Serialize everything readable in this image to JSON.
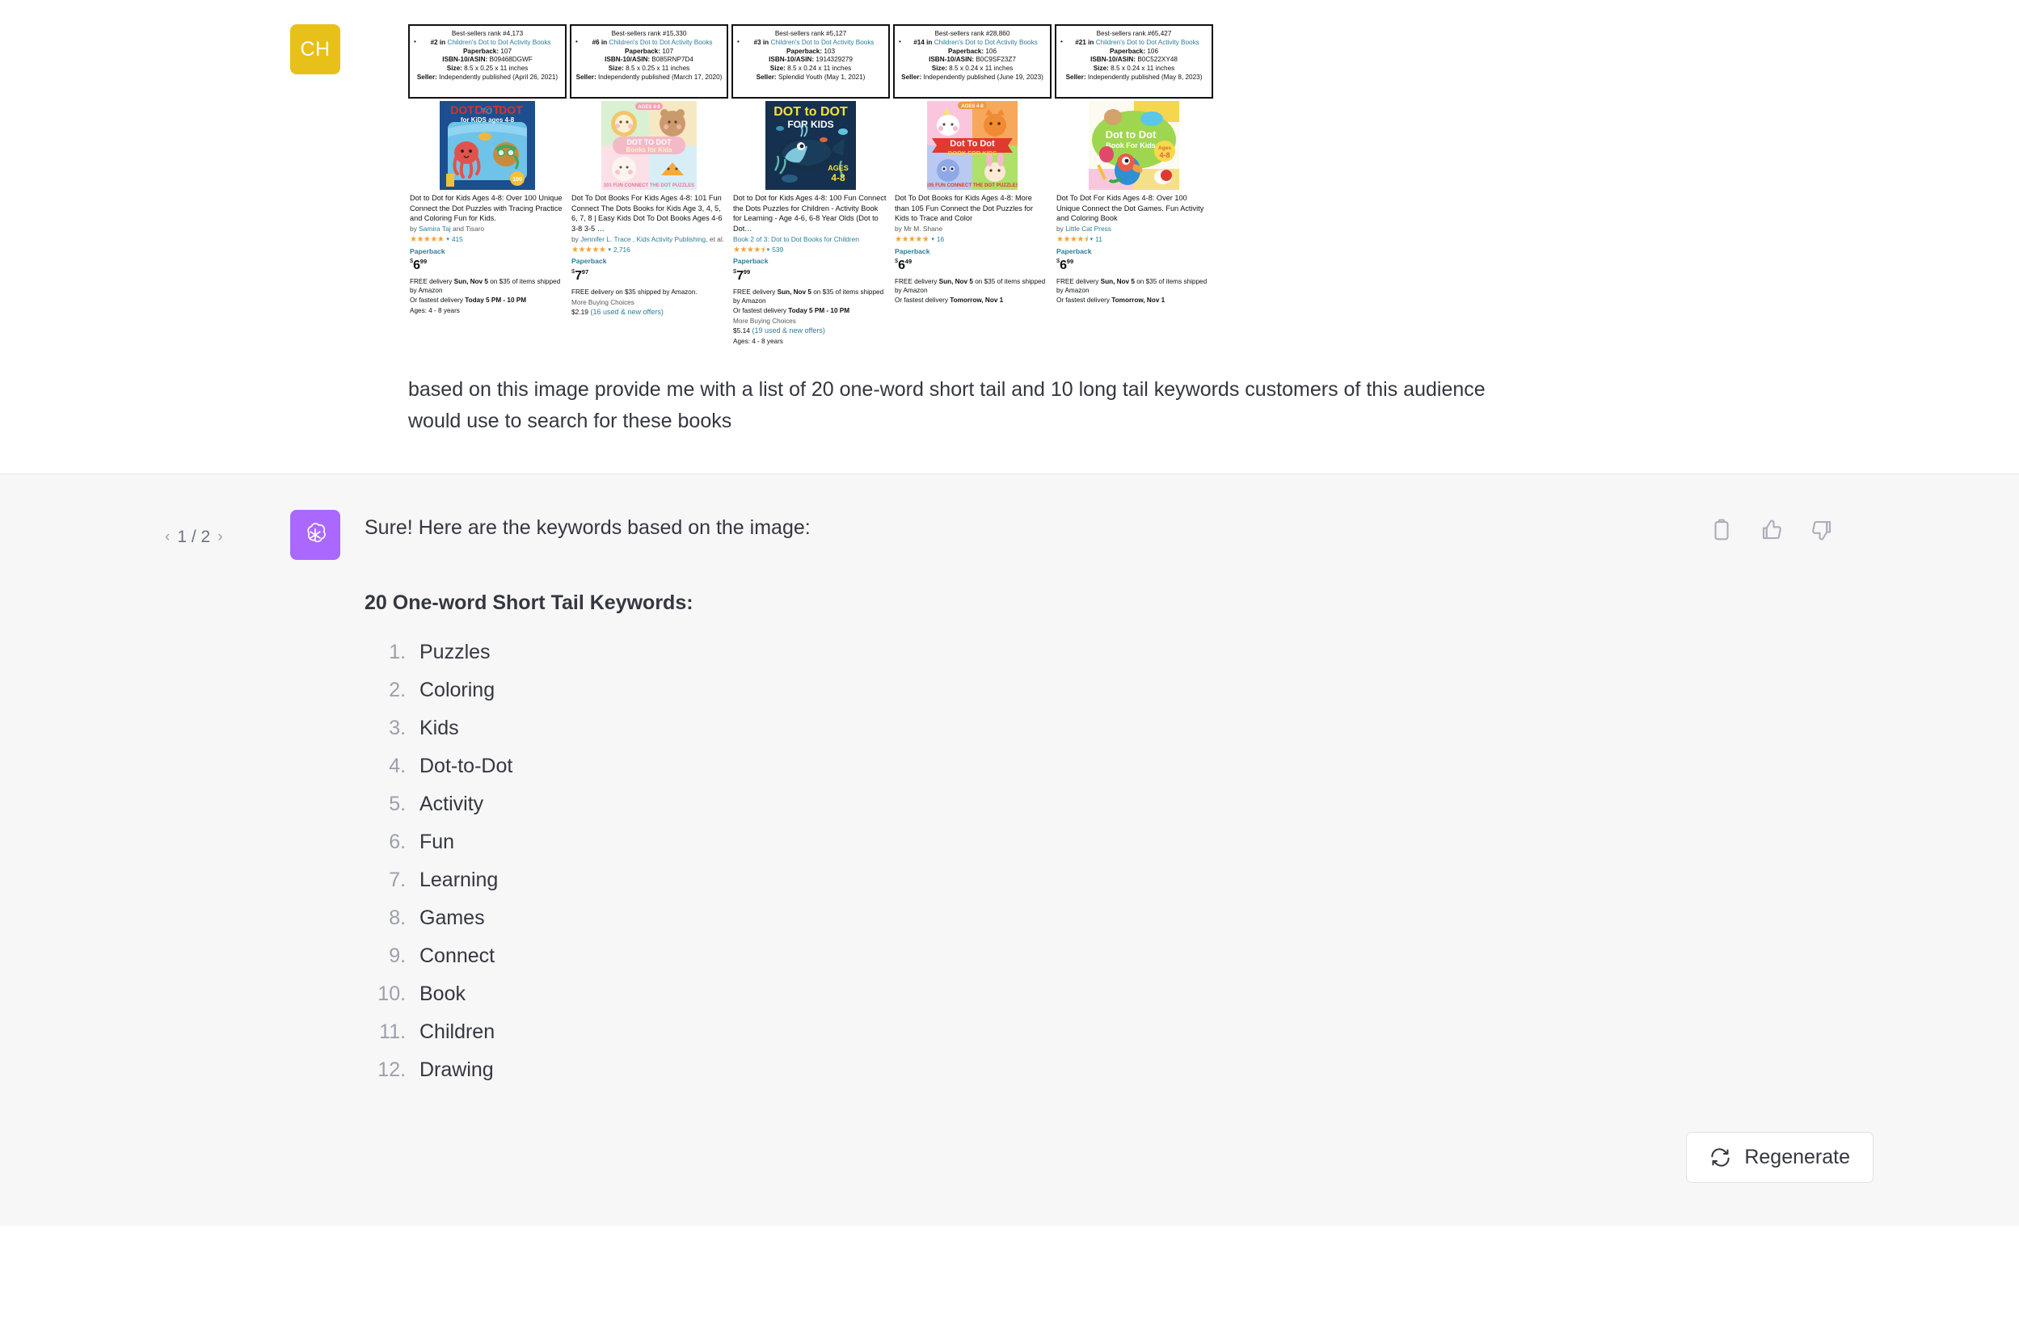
{
  "user": {
    "avatar_initials": "CH",
    "prompt": "based on this image provide me with a list of 20 one-word short tail and 10 long tail keywords customers of this audience would use to search for these books",
    "products": [
      {
        "rank_line": "Best-sellers rank #4,173",
        "cat_rank": "#2 in",
        "cat_link": "Children's Dot to Dot Activity Books",
        "paperback_label": "Paperback:",
        "paperback": "107",
        "isbn_label": "ISBN-10/ASIN:",
        "isbn": "B09468DGWF",
        "size_label": "Size:",
        "size": "8.5 x 0.25 x 11 inches",
        "seller_label": "Seller:",
        "seller": "Independently published (April 26, 2021)",
        "title": "Dot to Dot for Kids Ages 4-8: Over 100 Unique Connect the Dot Puzzles with Tracing Practice and Coloring Fun for Kids.",
        "by_prefix": "by",
        "authors": "Samira Taj",
        "by_suffix": "and Tisaro",
        "series": "",
        "stars": 5,
        "reviews": "415",
        "binding": "Paperback",
        "price_cur": "$",
        "price_whole": "6",
        "price_frac": "99",
        "ship1": "FREE delivery",
        "ship1_b": "Sun, Nov 5",
        "ship1_tail": "on $35 of items shipped by Amazon",
        "ship2": "Or fastest delivery",
        "ship2_b": "Today 5 PM - 10 PM",
        "more_buying": "",
        "mbc_price": "",
        "mbc_offers": "",
        "ages": "Ages: 4 - 8 years",
        "cover": "octopus-ocean-blue"
      },
      {
        "rank_line": "Best-sellers rank #15,330",
        "cat_rank": "#6 in",
        "cat_link": "Children's Dot to Dot Activity Books",
        "paperback_label": "Paperback:",
        "paperback": "107",
        "isbn_label": "ISBN-10/ASIN:",
        "isbn": "B085RNP7D4",
        "size_label": "Size:",
        "size": "8.5 x 0.25 x 11 inches",
        "seller_label": "Seller:",
        "seller": "Independently published (March 17, 2020)",
        "title": "Dot To Dot Books For Kids Ages 4-8: 101 Fun Connect The Dots Books for Kids Age 3, 4, 5, 6, 7, 8 | Easy Kids Dot To Dot Books Ages 4-6 3-8 3-5 …",
        "by_prefix": "by",
        "authors": "Jennifer L. Trace , Kids Activity Publishing",
        "by_suffix": ", et al.",
        "series": "",
        "stars": 5,
        "reviews": "2,716",
        "binding": "Paperback",
        "price_cur": "$",
        "price_whole": "7",
        "price_frac": "97",
        "ship1": "FREE delivery on $35 shipped by Amazon.",
        "ship1_b": "",
        "ship1_tail": "",
        "ship2": "",
        "ship2_b": "",
        "more_buying": "More Buying Choices",
        "mbc_price": "$2.19",
        "mbc_offers": "(16 used & new offers)",
        "ages": "",
        "cover": "pastel-animals"
      },
      {
        "rank_line": "Best-sellers rank #5,127",
        "cat_rank": "#3 in",
        "cat_link": "Children's Dot to Dot Activity Books",
        "paperback_label": "Paperback:",
        "paperback": "103",
        "isbn_label": "ISBN-10/ASIN:",
        "isbn": "1914329279",
        "size_label": "Size:",
        "size": "8.5 x 0.24 x 11 inches",
        "seller_label": "Seller:",
        "seller": "Splendid Youth (May 1, 2021)",
        "title": "Dot to Dot for Kids Ages 4-8: 100 Fun Connect the Dots Puzzles for Children - Activity Book for Learning - Age 4-6, 6-8 Year Olds (Dot to Dot…",
        "by_prefix": "",
        "authors": "",
        "by_suffix": "",
        "series": "Book 2 of 3: Dot to Dot Books for Children",
        "stars": 4.5,
        "reviews": "539",
        "binding": "Paperback",
        "price_cur": "$",
        "price_whole": "7",
        "price_frac": "99",
        "ship1": "FREE delivery",
        "ship1_b": "Sun, Nov 5",
        "ship1_tail": "on $35 of items shipped by Amazon",
        "ship2": "Or fastest delivery",
        "ship2_b": "Today 5 PM - 10 PM",
        "more_buying": "More Buying Choices",
        "mbc_price": "$5.14",
        "mbc_offers": "(19 used & new offers)",
        "ages": "Ages: 4 - 8 years",
        "cover": "whale-navy"
      },
      {
        "rank_line": "Best-sellers rank #28,860",
        "cat_rank": "#14 in",
        "cat_link": "Children's Dot to Dot Activity Books",
        "paperback_label": "Paperback:",
        "paperback": "106",
        "isbn_label": "ISBN-10/ASIN:",
        "isbn": "B0C9SF23Z7",
        "size_label": "Size:",
        "size": "8.5 x 0.24 x 11 inches",
        "seller_label": "Seller:",
        "seller": "Independently published (June 19, 2023)",
        "title": "Dot To Dot Books for Kids Ages 4-8: More than 105 Fun Connect the Dot Puzzles for Kids to Trace and Color",
        "by_prefix": "by",
        "authors": "Mr M. Shane",
        "by_suffix": "",
        "series": "",
        "stars": 5,
        "reviews": "16",
        "binding": "Paperback",
        "price_cur": "$",
        "price_whole": "6",
        "price_frac": "49",
        "ship1": "FREE delivery",
        "ship1_b": "Sun, Nov 5",
        "ship1_tail": "on $35 of items shipped by Amazon",
        "ship2": "Or fastest delivery",
        "ship2_b": "Tomorrow, Nov 1",
        "more_buying": "",
        "mbc_price": "",
        "mbc_offers": "",
        "ages": "",
        "cover": "quad-animals-red-banner"
      },
      {
        "rank_line": "Best-sellers rank #65,427",
        "cat_rank": "#21 in",
        "cat_link": "Children's Dot to Dot Activity Books",
        "paperback_label": "Paperback:",
        "paperback": "106",
        "isbn_label": "ISBN-10/ASIN:",
        "isbn": "B0C522XY48",
        "size_label": "Size:",
        "size": "8.5 x 0.24 x 11 inches",
        "seller_label": "Seller:",
        "seller": "Independently published (May 8, 2023)",
        "title": "Dot To Dot For Kids Ages 4-8: Over 100 Unique Connect the Dot Games. Fun Activity and Coloring Book",
        "by_prefix": "by",
        "authors": "Little Cat Press",
        "by_suffix": "",
        "series": "",
        "stars": 4.5,
        "reviews": "11",
        "binding": "Paperback",
        "price_cur": "$",
        "price_whole": "6",
        "price_frac": "99",
        "ship1": "FREE delivery",
        "ship1_b": "Sun, Nov 5",
        "ship1_tail": "on $35 of items shipped by Amazon",
        "ship2": "Or fastest delivery",
        "ship2_b": "Tomorrow, Nov 1",
        "more_buying": "",
        "mbc_price": "",
        "mbc_offers": "",
        "ages": "",
        "cover": "parrot-green"
      }
    ]
  },
  "assistant": {
    "pager": {
      "prev": "‹",
      "count": "1 / 2",
      "next": "›"
    },
    "lead": "Sure! Here are the keywords based on the image:",
    "section_heading": "20 One-word Short Tail Keywords:",
    "keywords": [
      "Puzzles",
      "Coloring",
      "Kids",
      "Dot-to-Dot",
      "Activity",
      "Fun",
      "Learning",
      "Games",
      "Connect",
      "Book",
      "Children",
      "Drawing"
    ],
    "actions": [
      {
        "name": "copy-icon",
        "label": "Copy"
      },
      {
        "name": "thumbs-up-icon",
        "label": "Good response"
      },
      {
        "name": "thumbs-down-icon",
        "label": "Bad response"
      }
    ],
    "regenerate_label": "Regenerate"
  },
  "colors": {
    "user_avatar": "#e7c11a",
    "gpt_avatar": "#ab68ff",
    "assistant_bg": "#f7f7f8",
    "text": "#353740",
    "muted": "#9ca0ab",
    "link": "#2e7d9a",
    "star": "#f0a33a"
  }
}
